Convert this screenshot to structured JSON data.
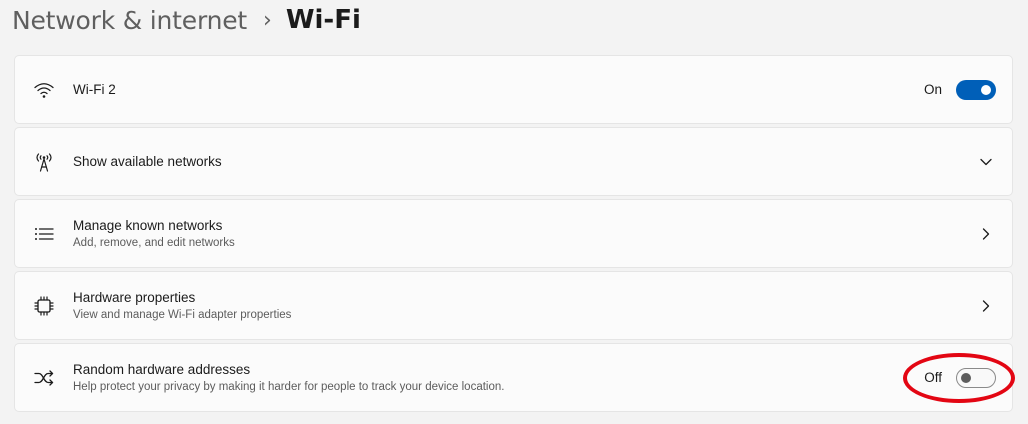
{
  "breadcrumb": {
    "parent": "Network & internet",
    "separator": "›",
    "current": "Wi-Fi"
  },
  "rows": [
    {
      "icon": "wifi-icon",
      "title": "Wi-Fi 2",
      "control": "toggle",
      "state_label": "On",
      "toggled": true
    },
    {
      "icon": "antenna-icon",
      "title": "Show available networks",
      "control": "expand-chevron"
    },
    {
      "icon": "list-icon",
      "title": "Manage known networks",
      "subtitle": "Add, remove, and edit networks",
      "control": "chevron-right"
    },
    {
      "icon": "chip-icon",
      "title": "Hardware properties",
      "subtitle": "View and manage Wi-Fi adapter properties",
      "control": "chevron-right"
    },
    {
      "icon": "shuffle-icon",
      "title": "Random hardware addresses",
      "subtitle": "Help protect your privacy by making it harder for people to track your device location.",
      "control": "toggle",
      "state_label": "Off",
      "toggled": false
    }
  ],
  "colors": {
    "accent": "#005fb8",
    "annotation": "#e30613",
    "background": "#f3f3f3",
    "card": "#fbfbfb"
  }
}
